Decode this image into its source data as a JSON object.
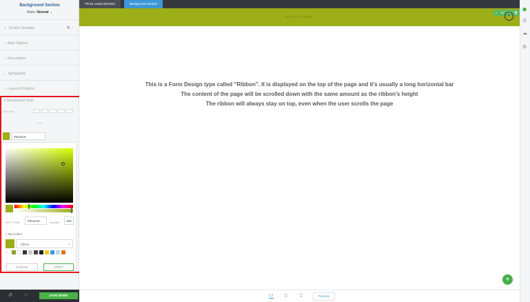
{
  "sidebar": {
    "title": "Background Section",
    "state_label": "State:",
    "state_value": "Normal",
    "state_chevron": "chevron-down-icon",
    "sections": [
      {
        "label": "Section Template"
      },
      {
        "label": "Main Options"
      },
      {
        "label": "Decorations"
      },
      {
        "label": "Typography"
      },
      {
        "label": "Layout & Position"
      }
    ],
    "template_icons": "▣ ⌄"
  },
  "background_style": {
    "title": "Background Style",
    "add_layer_label": "Add layer",
    "sub_label": "Solid",
    "hex_value": "#9cae18",
    "color_hex": "#9cae18"
  },
  "picker": {
    "hex_label": "HEX / RGB",
    "hex_value": "#9cae18",
    "opacity_label": "Opacity",
    "opacity_value": "100",
    "my_colors_label": "My Colors",
    "color_set_value": "Citron",
    "swatches": [
      "#8da02b",
      "#ffffff",
      "#333333",
      "#cccccc",
      "#444444",
      "#1f1f1f",
      "#f2c811",
      "#3d98d8",
      "#b8dbe9",
      "#e4731f"
    ],
    "cancel_label": "CANCEL",
    "apply_label": "APPLY"
  },
  "bottom": {
    "save_label": "SAVE WORK"
  },
  "topbar": {
    "breadcrumb_1": "Thrive Leads Element",
    "breadcrumb_2": "Background Section"
  },
  "canvas": {
    "ribbon_text": "Background Section",
    "ribbon_color": "#9cae18",
    "close_glyph": "×",
    "description": [
      "This is a Form Design type called \"Ribbon\". It is displayed on the top of the page and it's usually a long horizontal bar",
      "The content of the page will be scrolled down with the same amount as the ribbon's height",
      "The ribbon will always stay on top, even when the user scrolls the page"
    ]
  },
  "device_bar": {
    "preview_label": "Preview"
  }
}
